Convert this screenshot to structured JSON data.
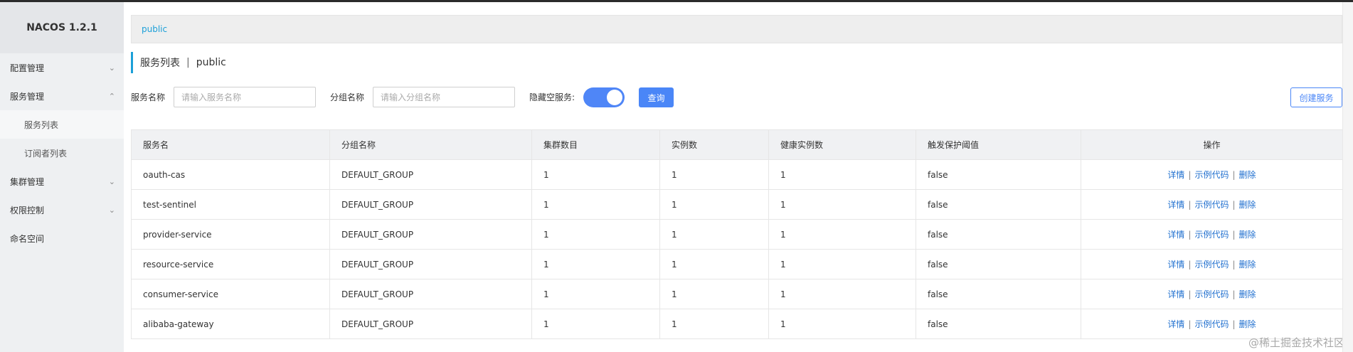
{
  "brand": "NACOS 1.2.1",
  "sidebar": {
    "items": [
      {
        "label": "配置管理"
      },
      {
        "label": "服务管理"
      },
      {
        "label": "服务列表"
      },
      {
        "label": "订阅者列表"
      },
      {
        "label": "集群管理"
      },
      {
        "label": "权限控制"
      },
      {
        "label": "命名空间"
      }
    ]
  },
  "breadcrumb": {
    "namespace": "public"
  },
  "page": {
    "title": "服务列表",
    "separator": "|",
    "namespace": "public"
  },
  "filters": {
    "service_name_label": "服务名称",
    "service_name_placeholder": "请输入服务名称",
    "group_name_label": "分组名称",
    "group_name_placeholder": "请输入分组名称",
    "hide_empty_label": "隐藏空服务:",
    "hide_empty_on": true,
    "query_label": "查询",
    "create_label": "创建服务"
  },
  "table": {
    "headers": [
      "服务名",
      "分组名称",
      "集群数目",
      "实例数",
      "健康实例数",
      "触发保护阈值",
      "操作"
    ],
    "rows": [
      [
        "oauth-cas",
        "DEFAULT_GROUP",
        "1",
        "1",
        "1",
        "false"
      ],
      [
        "test-sentinel",
        "DEFAULT_GROUP",
        "1",
        "1",
        "1",
        "false"
      ],
      [
        "provider-service",
        "DEFAULT_GROUP",
        "1",
        "1",
        "1",
        "false"
      ],
      [
        "resource-service",
        "DEFAULT_GROUP",
        "1",
        "1",
        "1",
        "false"
      ],
      [
        "consumer-service",
        "DEFAULT_GROUP",
        "1",
        "1",
        "1",
        "false"
      ],
      [
        "alibaba-gateway",
        "DEFAULT_GROUP",
        "1",
        "1",
        "1",
        "false"
      ]
    ],
    "actions": {
      "detail": "详情",
      "sample": "示例代码",
      "delete": "删除",
      "sep": "|"
    }
  },
  "watermark": "@稀土掘金技术社区",
  "colors": {
    "accent": "#1ca0d8",
    "primary": "#4a86f7",
    "link": "#1f6fcf"
  }
}
